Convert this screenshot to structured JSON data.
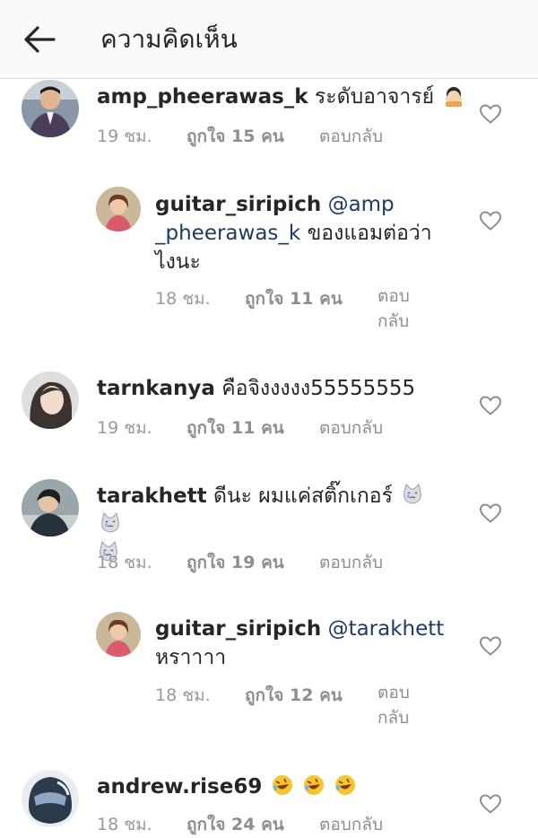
{
  "header": {
    "title": "ความคิดเห็น"
  },
  "comments": [
    {
      "username": "amp_pheerawas_k",
      "text": "ระดับอาจารย์",
      "time": "19 ชม.",
      "likes": "ถูกใจ 15 คน",
      "reply": "ตอบกลับ"
    },
    {
      "username": "guitar_siripich",
      "mention_a": "@amp",
      "mention_b": "_pheerawas_k",
      "text_a": "ของแอมต่อว่า",
      "text_b": "ไงนะ",
      "time": "18 ชม.",
      "likes": "ถูกใจ 11 คน",
      "reply_a": "ตอบ",
      "reply_b": "กลับ"
    },
    {
      "username": "tarnkanya",
      "text": "คือจิงงงงง55555555",
      "time": "19 ชม.",
      "likes": "ถูกใจ 11 คน",
      "reply": "ตอบกลับ"
    },
    {
      "username": "tarakhett",
      "text": "ดีนะ ผมแค่สติ๊กเกอร์",
      "time": "18 ชม.",
      "likes": "ถูกใจ 19 คน",
      "reply": "ตอบกลับ"
    },
    {
      "username": "guitar_siripich",
      "mention": "@tarakhett",
      "text": "หราาาา",
      "time": "18 ชม.",
      "likes": "ถูกใจ 12 คน",
      "reply_a": "ตอบ",
      "reply_b": "กลับ"
    },
    {
      "username": "andrew.rise69",
      "text": "",
      "time": "18 ชม.",
      "likes": "ถูกใจ 24 คน",
      "reply": "ตอบกลับ"
    }
  ],
  "icons": {
    "back": "arrow-left-icon",
    "like": "heart-outline-icon",
    "emoji_a": "hands-over-face-emoji",
    "emoji_b": "crying-cat-emoji",
    "emoji_c": "rolling-laughing-emoji"
  },
  "colors": {
    "mention": "#1e3a63",
    "meta": "#999999",
    "heart": "#8e8e8e"
  }
}
